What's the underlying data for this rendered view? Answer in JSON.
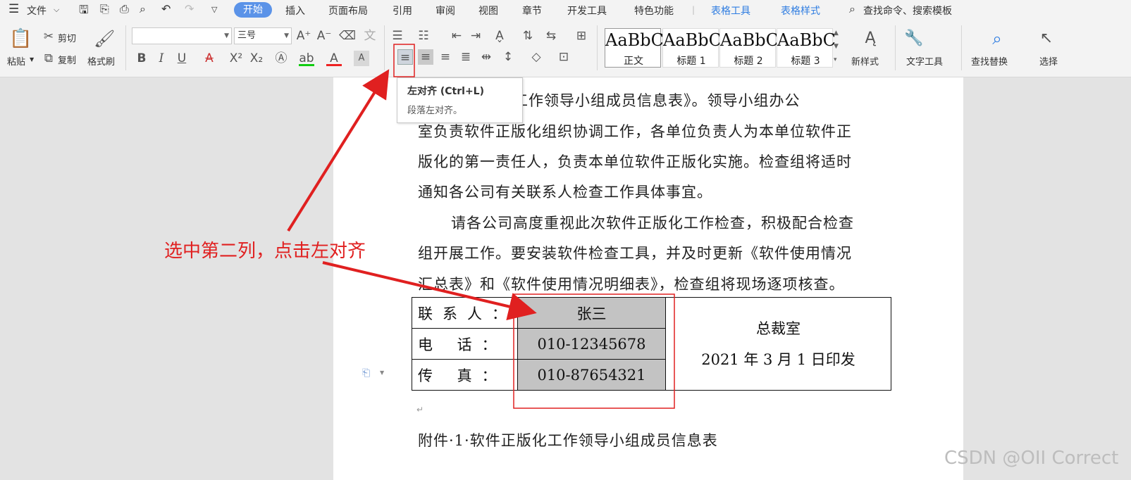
{
  "menubar": {
    "file": "文件",
    "tabs": [
      "开始",
      "插入",
      "页面布局",
      "引用",
      "审阅",
      "视图",
      "章节",
      "开发工具",
      "特色功能"
    ],
    "context_tabs": [
      "表格工具",
      "表格样式"
    ],
    "search": "查找命令、搜索模板"
  },
  "ribbon": {
    "paste": "粘贴",
    "cut": "剪切",
    "copy": "复制",
    "format_painter": "格式刷",
    "font_name": "",
    "font_size": "三号",
    "styles": [
      {
        "sample": "AaBbC",
        "name": "正文"
      },
      {
        "sample": "AaBbC",
        "name": "标题 1"
      },
      {
        "sample": "AaBbC",
        "name": "标题 2"
      },
      {
        "sample": "AaBbC",
        "name": "标题 3"
      }
    ],
    "new_style": "新样式",
    "text_tools": "文字工具",
    "find_replace": "查找替换",
    "select": "选择"
  },
  "tooltip": {
    "title": "左对齐 (Ctrl+L)",
    "desc": "段落左对齐。"
  },
  "document": {
    "lines": [
      "件正版化工作领导小组成员信息表》。领导小组办公",
      "室负责软件正版化组织协调工作，各单位负责人为本单位软件正",
      "版化的第一责任人，负责本单位软件正版化实施。检查组将适时",
      "通知各公司有关联系人检查工作具体事宜。",
      "请各公司高度重视此次软件正版化工作检查，积极配合检查",
      "组开展工作。要安装软件检查工具，并及时更新《软件使用情况",
      "汇总表》和《软件使用情况明细表》，检查组将现场逐项核查。"
    ],
    "attachment": "附件·1·软件正版化工作领导小组成员信息表"
  },
  "table": {
    "rows": [
      {
        "label": "联系人：",
        "value": "张三"
      },
      {
        "label": "电  话：",
        "value": "010-12345678"
      },
      {
        "label": "传  真：",
        "value": "010-87654321"
      }
    ],
    "right_line1": "总裁室",
    "right_line2": "2021 年 3 月 1 日印发"
  },
  "annotation": "选中第二列，点击左对齐",
  "watermark": "CSDN @OII Correct",
  "colors": {
    "accent": "#5b93e8",
    "annotation": "#e02020",
    "selection": "#c3c3c3"
  }
}
